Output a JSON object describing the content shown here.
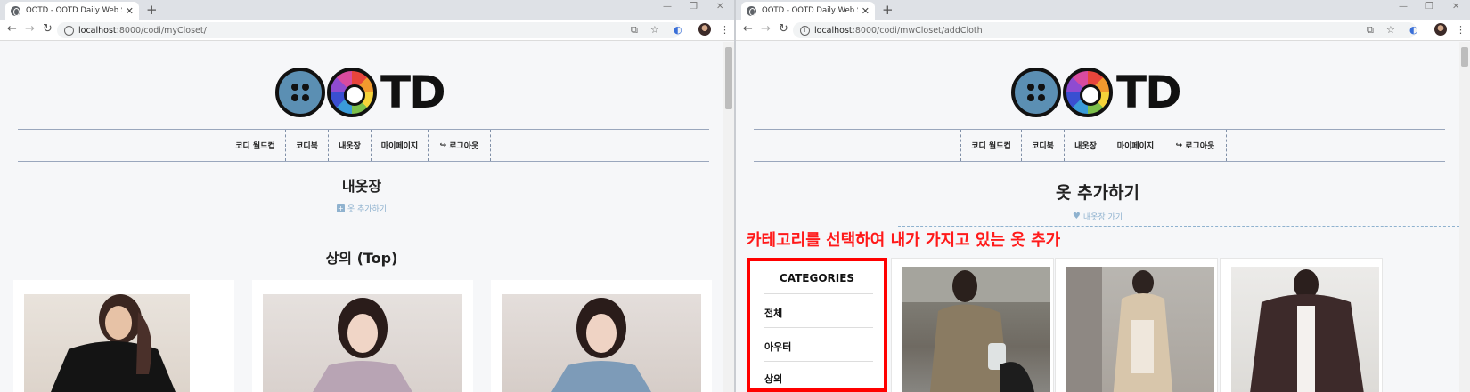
{
  "left": {
    "tab_title": "OOTD - OOTD Daily Web Serv",
    "url_host": "localhost",
    "url_path": ":8000/codi/myCloset/",
    "nav": [
      "코디 월드컵",
      "코디북",
      "내옷장",
      "마이페이지",
      "로그아웃"
    ],
    "page_title": "내옷장",
    "add_link": "옷 추가하기",
    "section_title": "상의 (Top)"
  },
  "right": {
    "tab_title": "OOTD - OOTD Daily Web Serv",
    "url_host": "localhost",
    "url_path": ":8000/codi/mwCloset/addCloth",
    "nav": [
      "코디 월드컵",
      "코디북",
      "내옷장",
      "마이페이지",
      "로그아웃"
    ],
    "page_title": "옷 추가하기",
    "back_link": "내옷장 가기",
    "annotation": "카테고리를 선택하여 내가 가지고 있는 옷 추가",
    "categories_title": "CATEGORIES",
    "categories": [
      "전체",
      "아우터",
      "상의"
    ]
  },
  "logo_text": "TD",
  "colors": {
    "accent": "#8fb2cf",
    "annotation": "#ff1a1a",
    "nav_border": "#9aa7bd"
  },
  "icons": {
    "logout": "sign-out-icon",
    "add": "plus-square-icon",
    "back": "heart-icon"
  }
}
